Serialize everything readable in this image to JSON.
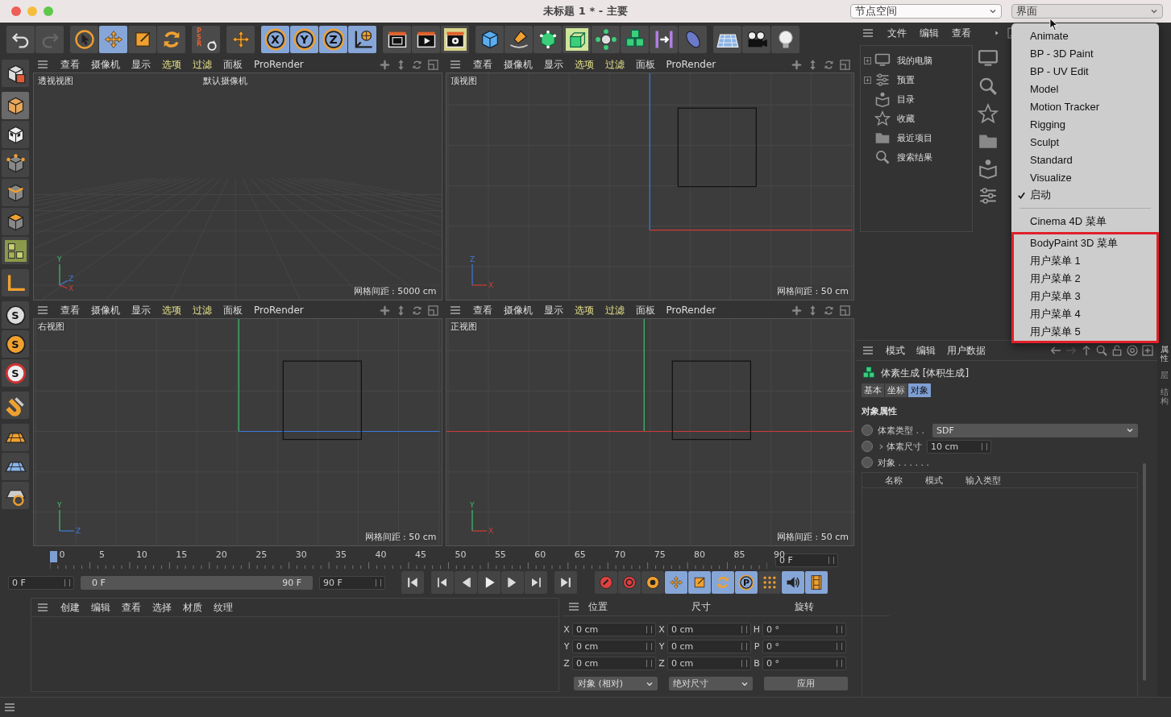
{
  "window": {
    "title": "未标题 1 * - 主要"
  },
  "header_selects": [
    {
      "value": "节点空间",
      "open": false
    },
    {
      "value": "界面",
      "open": true
    }
  ],
  "toolbar": [
    {
      "items": [
        {
          "kind": "undo",
          "selected": false
        },
        {
          "kind": "redo",
          "selected": false
        }
      ]
    },
    {
      "items": [
        {
          "kind": "select",
          "selected": false
        },
        {
          "kind": "move",
          "selected": true
        },
        {
          "kind": "scale",
          "selected": false
        },
        {
          "kind": "rotate",
          "selected": false
        }
      ]
    },
    {
      "items": [
        {
          "kind": "psr",
          "selected": false,
          "label": "PSR"
        }
      ]
    },
    {
      "items": [
        {
          "kind": "move",
          "selected": false
        }
      ]
    },
    {
      "items": [
        {
          "kind": "axis",
          "selected": true,
          "label": "X"
        },
        {
          "kind": "axis",
          "selected": true,
          "label": "Y"
        },
        {
          "kind": "axis",
          "selected": true,
          "label": "Z"
        },
        {
          "kind": "world",
          "selected": true
        }
      ]
    },
    {
      "items": [
        {
          "kind": "render-view",
          "selected": false
        },
        {
          "kind": "render-picture",
          "selected": false
        },
        {
          "kind": "render-settings",
          "selected": false
        }
      ]
    },
    {
      "items": [
        {
          "kind": "cube",
          "selected": false
        },
        {
          "kind": "pen",
          "selected": false
        },
        {
          "kind": "subdivision",
          "selected": false
        },
        {
          "kind": "extrude",
          "selected": false
        },
        {
          "kind": "cloner",
          "selected": false
        },
        {
          "kind": "voxel",
          "selected": false
        },
        {
          "kind": "deformer",
          "selected": false
        },
        {
          "kind": "field",
          "selected": false
        }
      ]
    },
    {
      "items": [
        {
          "kind": "floor",
          "selected": false
        },
        {
          "kind": "camera",
          "selected": false
        },
        {
          "kind": "light",
          "selected": false
        }
      ]
    }
  ],
  "left_tools": [
    {
      "items": [
        {
          "kind": "convert",
          "selected": false
        }
      ]
    },
    {
      "items": [
        {
          "kind": "model",
          "selected": true
        },
        {
          "kind": "texture",
          "selected": false
        },
        {
          "kind": "point",
          "selected": false
        },
        {
          "kind": "edge",
          "selected": false
        },
        {
          "kind": "polygon",
          "selected": false
        },
        {
          "kind": "uv",
          "selected": false
        }
      ]
    },
    {
      "items": [
        {
          "kind": "axis-corner",
          "selected": false
        }
      ]
    },
    {
      "items": [
        {
          "kind": "snap",
          "selected": false,
          "label": "S"
        },
        {
          "kind": "snap-alt",
          "selected": false,
          "label": "S"
        },
        {
          "kind": "snap-ring",
          "selected": false,
          "label": "S"
        }
      ]
    },
    {
      "items": [
        {
          "kind": "magnet",
          "selected": false
        }
      ]
    },
    {
      "items": [
        {
          "kind": "grid-plane",
          "selected": false
        },
        {
          "kind": "workplane",
          "selected": false
        },
        {
          "kind": "solo",
          "selected": false
        }
      ]
    }
  ],
  "viewports": [
    {
      "kind": "perspective",
      "name": "透视视图",
      "camera": "默认摄像机",
      "grid": "网格间距 : 5000 cm",
      "gizmo": [
        "Y",
        "Z",
        "X"
      ],
      "menu": [
        {
          "label": "查看",
          "highlighted": false
        },
        {
          "label": "摄像机",
          "highlighted": false
        },
        {
          "label": "显示",
          "highlighted": false
        },
        {
          "label": "选项",
          "highlighted": true
        },
        {
          "label": "过滤",
          "highlighted": true
        },
        {
          "label": "面板",
          "highlighted": false
        },
        {
          "label": "ProRender",
          "highlighted": false
        }
      ]
    },
    {
      "kind": "top",
      "name": "顶视图",
      "grid": "网格间距 : 50 cm",
      "gizmo": [
        "Z",
        "X"
      ],
      "menu": [
        {
          "label": "查看",
          "highlighted": false
        },
        {
          "label": "摄像机",
          "highlighted": false
        },
        {
          "label": "显示",
          "highlighted": false
        },
        {
          "label": "选项",
          "highlighted": true
        },
        {
          "label": "过滤",
          "highlighted": true
        },
        {
          "label": "面板",
          "highlighted": false
        },
        {
          "label": "ProRender",
          "highlighted": false
        }
      ]
    },
    {
      "kind": "right",
      "name": "右视图",
      "grid": "网格间距 : 50 cm",
      "gizmo": [
        "Y",
        "Z"
      ],
      "menu": [
        {
          "label": "查看",
          "highlighted": false
        },
        {
          "label": "摄像机",
          "highlighted": false
        },
        {
          "label": "显示",
          "highlighted": false
        },
        {
          "label": "选项",
          "highlighted": true
        },
        {
          "label": "过滤",
          "highlighted": true
        },
        {
          "label": "面板",
          "highlighted": false
        },
        {
          "label": "ProRender",
          "highlighted": false
        }
      ]
    },
    {
      "kind": "front",
      "name": "正视图",
      "grid": "网格间距 : 50 cm",
      "gizmo": [
        "Y",
        "X"
      ],
      "menu": [
        {
          "label": "查看",
          "highlighted": false
        },
        {
          "label": "摄像机",
          "highlighted": false
        },
        {
          "label": "显示",
          "highlighted": false
        },
        {
          "label": "选项",
          "highlighted": true
        },
        {
          "label": "过滤",
          "highlighted": true
        },
        {
          "label": "面板",
          "highlighted": false
        },
        {
          "label": "ProRender",
          "highlighted": false
        }
      ]
    }
  ],
  "timeline": {
    "ticks": [
      "0",
      "5",
      "10",
      "15",
      "20",
      "25",
      "30",
      "35",
      "40",
      "45",
      "50",
      "55",
      "60",
      "65",
      "70",
      "75",
      "80",
      "85",
      "90"
    ],
    "level": 0,
    "frame_field": "0 F",
    "start_field": "0 F",
    "range_start": "0 F",
    "range_end": "90 F",
    "end_field": "90 F",
    "transport": [
      {
        "kind": "go-start",
        "selected": false
      },
      {
        "kind": "prev-key",
        "selected": false
      },
      {
        "kind": "prev-frame",
        "selected": false
      },
      {
        "kind": "play",
        "selected": false
      },
      {
        "kind": "next-frame",
        "selected": false
      },
      {
        "kind": "next-key",
        "selected": false
      },
      {
        "kind": "go-end",
        "selected": false
      }
    ],
    "keys": [
      {
        "kind": "record",
        "selected": false
      },
      {
        "kind": "autokey",
        "selected": false
      },
      {
        "kind": "key-settings",
        "selected": false
      },
      {
        "kind": "move",
        "selected": true
      },
      {
        "kind": "scale",
        "selected": true
      },
      {
        "kind": "rotate",
        "selected": true
      },
      {
        "kind": "axis",
        "selected": true,
        "label": "P"
      },
      {
        "kind": "dots",
        "selected": false
      },
      {
        "kind": "sound",
        "selected": true
      },
      {
        "kind": "film",
        "selected": true
      }
    ]
  },
  "materials": {
    "menu": [
      "创建",
      "编辑",
      "查看",
      "选择",
      "材质",
      "纹理"
    ]
  },
  "coordinates": {
    "headers": [
      "位置",
      "尺寸",
      "旋转"
    ],
    "rows": [
      {
        "pos_axis": "X",
        "pos": "0 cm",
        "size_axis": "X",
        "size": "0 cm",
        "rot_axis": "H",
        "rot": "0 °"
      },
      {
        "pos_axis": "Y",
        "pos": "0 cm",
        "size_axis": "Y",
        "size": "0 cm",
        "rot_axis": "P",
        "rot": "0 °"
      },
      {
        "pos_axis": "Z",
        "pos": "0 cm",
        "size_axis": "Z",
        "size": "0 cm",
        "rot_axis": "B",
        "rot": "0 °"
      }
    ],
    "dropdowns": [
      "对象 (相对)",
      "绝对尺寸"
    ],
    "apply": "应用"
  },
  "browser": {
    "menu": [
      "文件",
      "编辑",
      "查看"
    ],
    "tree": [
      {
        "label": "我的电脑",
        "kind": "monitor",
        "expandable": true
      },
      {
        "label": "预置",
        "kind": "sliders",
        "expandable": true
      },
      {
        "label": "目录",
        "kind": "book",
        "expandable": false
      },
      {
        "label": "收藏",
        "kind": "star",
        "expandable": false
      },
      {
        "label": "最近项目",
        "kind": "folder",
        "expandable": false
      },
      {
        "label": "搜索结果",
        "kind": "search",
        "expandable": false
      }
    ]
  },
  "attributes": {
    "menu": [
      "模式",
      "编辑",
      "用户数据"
    ],
    "title": "体素生成 [体积生成]",
    "tabs": [
      {
        "label": "基本",
        "selected": false
      },
      {
        "label": "坐标",
        "selected": false
      },
      {
        "label": "对象",
        "selected": true
      }
    ],
    "section": "对象属性",
    "params": [
      {
        "kind": "dropdown",
        "label": "体素类型 . .",
        "value": "SDF",
        "keyed": false
      },
      {
        "kind": "number",
        "label": "体素尺寸",
        "value": "10 cm",
        "keyed": false
      },
      {
        "kind": "list",
        "label": "对象 . . . . . .",
        "keyed": false
      }
    ],
    "columns": [
      "名称",
      "模式",
      "输入类型"
    ],
    "side_tabs": [
      "属性",
      "层",
      "结构"
    ]
  },
  "layout_menu": {
    "groups": [
      {
        "separator": false,
        "framed": false,
        "items": [
          {
            "label": "Animate",
            "checked": false
          },
          {
            "label": "BP - 3D Paint",
            "checked": false
          },
          {
            "label": "BP - UV Edit",
            "checked": false
          },
          {
            "label": "Model",
            "checked": false
          },
          {
            "label": "Motion Tracker",
            "checked": false
          },
          {
            "label": "Rigging",
            "checked": false
          },
          {
            "label": "Sculpt",
            "checked": false
          },
          {
            "label": "Standard",
            "checked": false
          },
          {
            "label": "Visualize",
            "checked": false
          },
          {
            "label": "启动",
            "checked": true
          }
        ]
      },
      {
        "separator": true,
        "framed": false,
        "items": [
          {
            "label": "Cinema 4D 菜单",
            "checked": false
          }
        ]
      },
      {
        "separator": false,
        "framed": true,
        "items": [
          {
            "label": "BodyPaint 3D 菜单",
            "checked": false
          },
          {
            "label": "用户菜单 1",
            "checked": false
          },
          {
            "label": "用户菜单 2",
            "checked": false
          },
          {
            "label": "用户菜单 3",
            "checked": false
          },
          {
            "label": "用户菜单 4",
            "checked": false
          },
          {
            "label": "用户菜单 5",
            "checked": false
          }
        ]
      }
    ]
  }
}
